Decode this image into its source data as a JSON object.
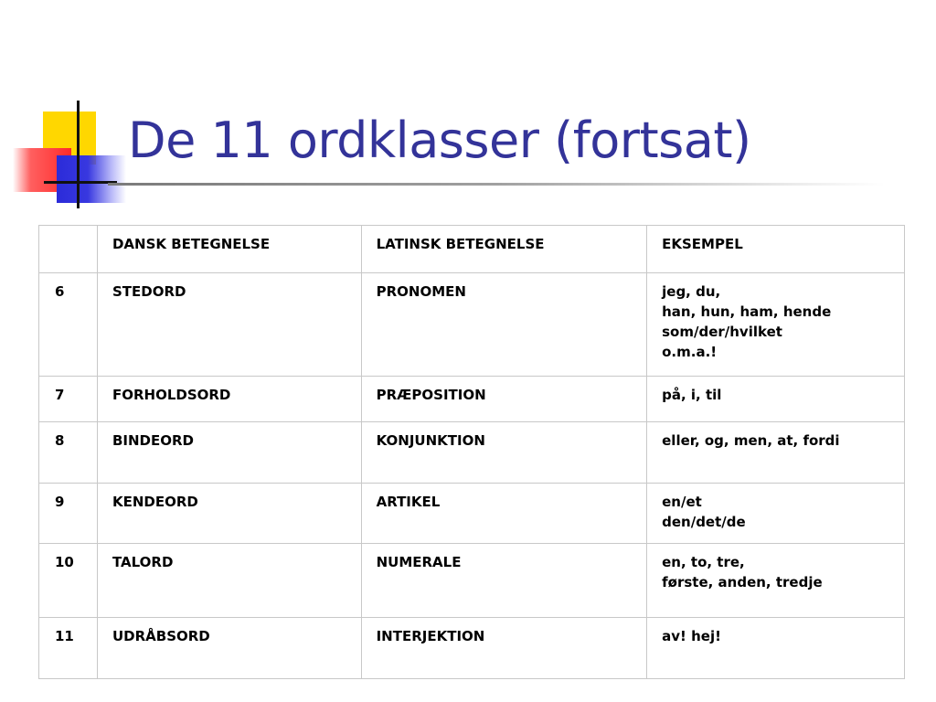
{
  "slide": {
    "title": "De 11 ordklasser (fortsat)"
  },
  "table": {
    "headers": [
      "",
      "DANSK BETEGNELSE",
      "LATINSK BETEGNELSE",
      "EKSEMPEL"
    ],
    "rows": [
      {
        "num": "6",
        "dansk": "STEDORD",
        "latinsk": "PRONOMEN",
        "eksempel": [
          "jeg, du,",
          "han, hun, ham, hende",
          "som/der/hvilket",
          "o.m.a.!"
        ]
      },
      {
        "num": "7",
        "dansk": "FORHOLDSORD",
        "latinsk": "PRÆPOSITION",
        "eksempel": [
          "på, i, til"
        ]
      },
      {
        "num": "8",
        "dansk": "BINDEORD",
        "latinsk": "KONJUNKTION",
        "eksempel": [
          "eller, og, men, at, fordi"
        ]
      },
      {
        "num": "9",
        "dansk": "KENDEORD",
        "latinsk": "ARTIKEL",
        "eksempel": [
          "en/et",
          "den/det/de"
        ]
      },
      {
        "num": "10",
        "dansk": "TALORD",
        "latinsk": "NUMERALE",
        "eksempel": [
          "en, to, tre,",
          "første, anden, tredje"
        ]
      },
      {
        "num": "11",
        "dansk": "UDRÅBSORD",
        "latinsk": "INTERJEKTION",
        "eksempel": [
          "av! hej!"
        ]
      }
    ]
  },
  "colors": {
    "title": "#333399",
    "logo_yellow": "#ffd700",
    "logo_red": "#ff2a2a",
    "logo_blue": "#2b2bd9",
    "table_border": "#c8c8c8"
  }
}
